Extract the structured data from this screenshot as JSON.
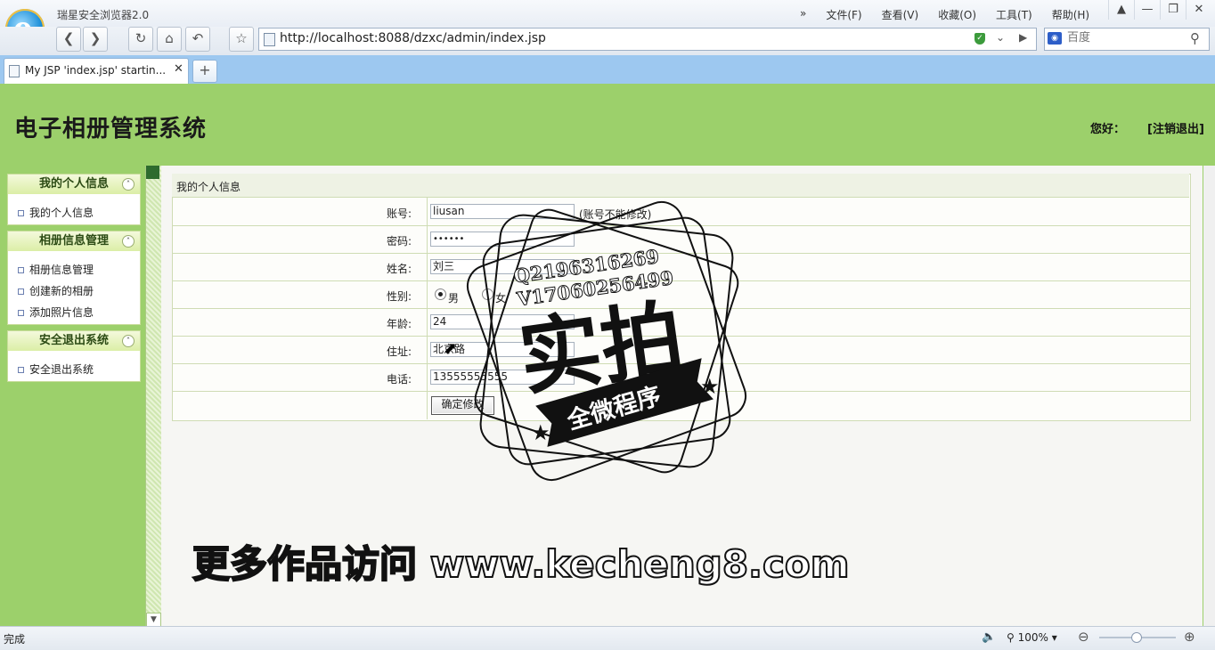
{
  "browser": {
    "app_name": "瑞星安全浏览器2.0",
    "menu": [
      "文件(F)",
      "查看(V)",
      "收藏(O)",
      "工具(T)",
      "帮助(H)"
    ],
    "menu_more": "»",
    "url": "http://localhost:8088/dzxc/admin/index.jsp",
    "search_placeholder": "百度",
    "tab_title": "My JSP 'index.jsp' startin...",
    "status": "完成",
    "zoom": "100%"
  },
  "header": {
    "title": "电子相册管理系统",
    "greeting": "您好：",
    "logout": "[注销退出]"
  },
  "sidebar": {
    "sections": [
      {
        "title": "我的个人信息",
        "items": [
          "我的个人信息"
        ]
      },
      {
        "title": "相册信息管理",
        "items": [
          "相册信息管理",
          "创建新的相册",
          "添加照片信息"
        ]
      },
      {
        "title": "安全退出系统",
        "items": [
          "安全退出系统"
        ]
      }
    ]
  },
  "form": {
    "caption": "我的个人信息",
    "account_label": "账号:",
    "account_value": "liusan",
    "account_note": "(账号不能修改)",
    "password_label": "密码:",
    "password_value": "••••••",
    "name_label": "姓名:",
    "name_value": "刘三",
    "gender_label": "性别:",
    "gender_male": "男",
    "gender_female": "女",
    "gender_selected": "男",
    "age_label": "年龄:",
    "age_value": "24",
    "address_label": "住址:",
    "address_value": "北京路",
    "phone_label": "电话:",
    "phone_value": "13555555555",
    "submit_label": "确定修改"
  },
  "watermark": {
    "contact_q": "Q2196316269",
    "contact_v": "V17060256499",
    "stamp_main": "实拍",
    "stamp_ribbon": "全微程序",
    "promo": "更多作品访问 www.kecheng8.com"
  }
}
